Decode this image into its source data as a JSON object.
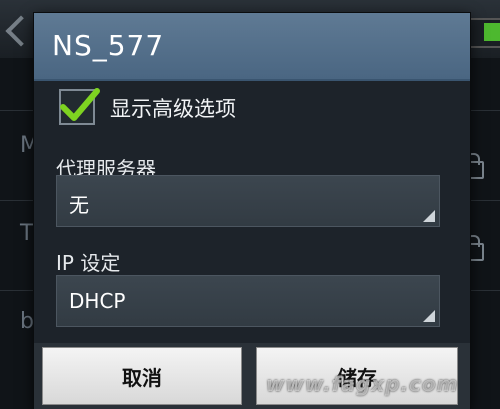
{
  "background": {
    "row_letters": [
      "M",
      "T",
      "b"
    ],
    "toggle_color": "#4db82f"
  },
  "dialog": {
    "title": "NS_577",
    "advanced_checkbox": {
      "label": "显示高级选项",
      "checked": true
    },
    "proxy": {
      "label": "代理服务器",
      "value": "无"
    },
    "ip": {
      "label": "IP 设定",
      "value": "DHCP"
    },
    "buttons": {
      "cancel": "取消",
      "save": "储存"
    }
  },
  "watermark": "www.fagxp.com"
}
